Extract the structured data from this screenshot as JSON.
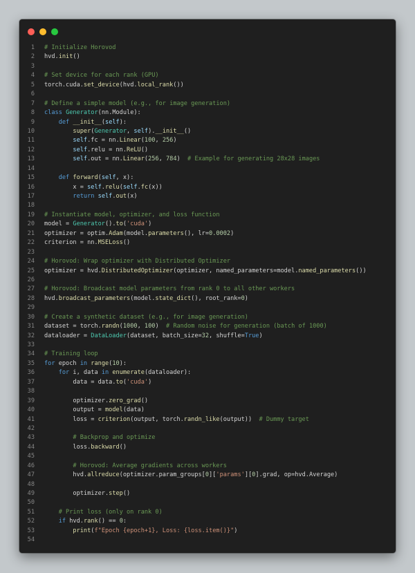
{
  "window": {
    "controls": [
      "close",
      "minimize",
      "maximize"
    ],
    "colors": {
      "close": "#ff5f57",
      "minimize": "#febc2e",
      "maximize": "#28c840",
      "background": "#1f1f1f"
    }
  },
  "code": {
    "language": "python",
    "lines": [
      "# Initialize Horovod",
      "hvd.init()",
      "",
      "# Set device for each rank (GPU)",
      "torch.cuda.set_device(hvd.local_rank())",
      "",
      "# Define a simple model (e.g., for image generation)",
      "class Generator(nn.Module):",
      "    def __init__(self):",
      "        super(Generator, self).__init__()",
      "        self.fc = nn.Linear(100, 256)",
      "        self.relu = nn.ReLU()",
      "        self.out = nn.Linear(256, 784)  # Example for generating 28x28 images",
      "",
      "    def forward(self, x):",
      "        x = self.relu(self.fc(x))",
      "        return self.out(x)",
      "",
      "# Instantiate model, optimizer, and loss function",
      "model = Generator().to('cuda')",
      "optimizer = optim.Adam(model.parameters(), lr=0.0002)",
      "criterion = nn.MSELoss()",
      "",
      "# Horovod: Wrap optimizer with Distributed Optimizer",
      "optimizer = hvd.DistributedOptimizer(optimizer, named_parameters=model.named_parameters())",
      "",
      "# Horovod: Broadcast model parameters from rank 0 to all other workers",
      "hvd.broadcast_parameters(model.state_dict(), root_rank=0)",
      "",
      "# Create a synthetic dataset (e.g., for image generation)",
      "dataset = torch.randn(1000, 100)  # Random noise for generation (batch of 1000)",
      "dataloader = DataLoader(dataset, batch_size=32, shuffle=True)",
      "",
      "# Training loop",
      "for epoch in range(10):",
      "    for i, data in enumerate(dataloader):",
      "        data = data.to('cuda')",
      "",
      "        optimizer.zero_grad()",
      "        output = model(data)",
      "        loss = criterion(output, torch.randn_like(output))  # Dummy target",
      "",
      "        # Backprop and optimize",
      "        loss.backward()",
      "",
      "        # Horovod: Average gradients across workers",
      "        hvd.allreduce(optimizer.param_groups[0]['params'][0].grad, op=hvd.Average)",
      "",
      "        optimizer.step()",
      "",
      "    # Print loss (only on rank 0)",
      "    if hvd.rank() == 0:",
      "        print(f\"Epoch {epoch+1}, Loss: {loss.item()}\")",
      ""
    ]
  }
}
